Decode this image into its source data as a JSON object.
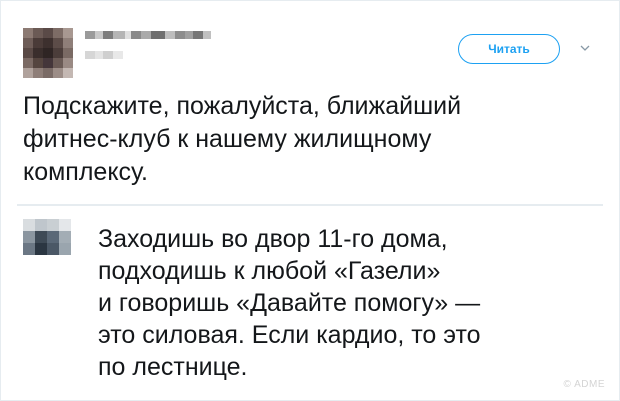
{
  "header": {
    "follow_label": "Читать",
    "chevron_icon": "chevron-down-icon",
    "accent_color": "#1da1f2"
  },
  "tweet": {
    "lines": [
      "Подскажите, пожалуйста, ближайший",
      "фитнес-клуб к нашему жилищному",
      "комплексу."
    ]
  },
  "reply": {
    "lines": [
      "Заходишь во двор 11-го дома,",
      "подходишь к любой «Газели»",
      "и говоришь «Давайте помогу» —",
      "это силовая. Если кардио, то это",
      "по лестнице."
    ]
  },
  "watermark": "© ADME"
}
